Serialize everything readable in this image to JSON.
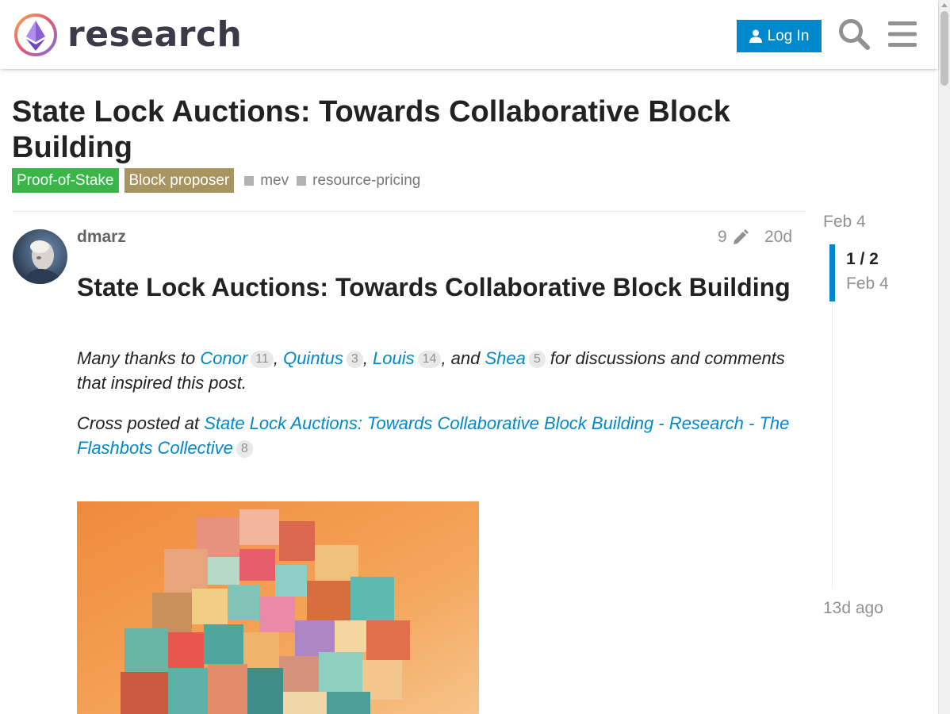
{
  "header": {
    "logo_text": "research",
    "login_label": "Log In",
    "search_icon": "search-icon",
    "menu_icon": "hamburger-menu-icon",
    "accent": "#0088cc"
  },
  "topic": {
    "title": "State Lock Auctions: Towards Collaborative Block Building",
    "categories": [
      {
        "label": "Proof-of-Stake",
        "color": "#3ab54a"
      },
      {
        "label": "Block proposer",
        "color": "#a79461"
      }
    ],
    "tags": [
      "mev",
      "resource-pricing"
    ]
  },
  "post": {
    "username": "dmarz",
    "edit_count": "9",
    "age": "20d",
    "heading": "State Lock Auctions: Towards Collaborative Block Building",
    "thanks": {
      "prefix": "Many thanks to ",
      "people": [
        {
          "name": "Conor",
          "count": "11"
        },
        {
          "name": "Quintus",
          "count": "3"
        },
        {
          "name": "Louis",
          "count": "14"
        },
        {
          "name": "Shea",
          "count": "5"
        }
      ],
      "sep1": ", ",
      "sep2": ", ",
      "sep3": ", and ",
      "suffix": " for discussions and comments that inspired this post."
    },
    "cross_post": {
      "prefix": "Cross posted at ",
      "link_text": "State Lock Auctions: Towards Collaborative Block Building - Research - The Flashbots Collective",
      "count": "8"
    }
  },
  "timeline": {
    "start_date": "Feb 4",
    "position": "1 / 2",
    "current_date": "Feb 4",
    "end_label": "13d ago"
  }
}
